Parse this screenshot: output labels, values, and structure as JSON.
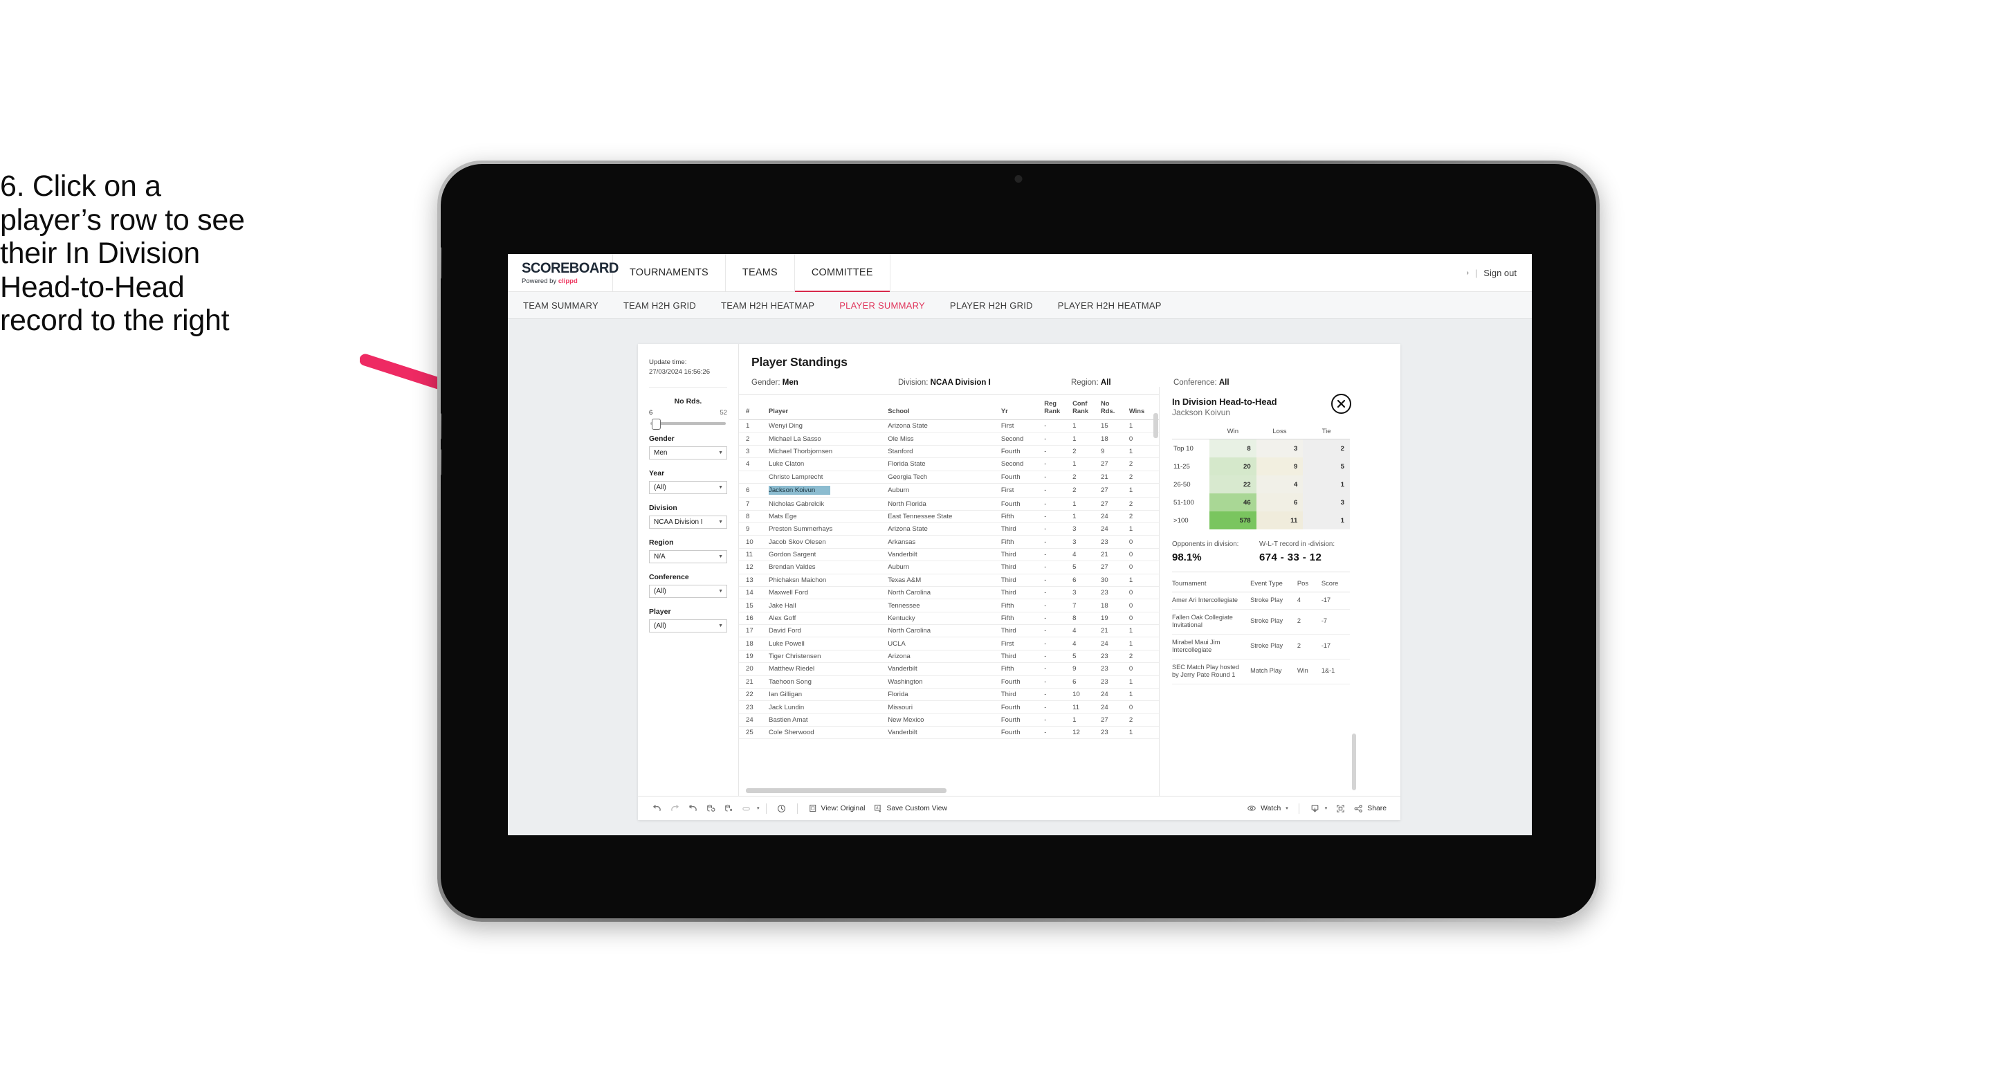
{
  "instruction": {
    "lines": [
      "6. Click on a",
      "player’s row to see",
      "their In Division",
      "Head-to-Head",
      "record to the right"
    ],
    "arrow_color": "#ee2a63"
  },
  "app": {
    "logo": {
      "word": "SCOREBOARD",
      "powered_prefix": "Powered by ",
      "brand": "clippd"
    },
    "topnav": [
      {
        "label": "TOURNAMENTS",
        "active": false
      },
      {
        "label": "TEAMS",
        "active": false
      },
      {
        "label": "COMMITTEE",
        "active": true
      }
    ],
    "topbar_right": {
      "chevron": "›",
      "separator": "|",
      "sign_out": "Sign out"
    },
    "subnav": [
      {
        "label": "TEAM SUMMARY",
        "active": false
      },
      {
        "label": "TEAM H2H GRID",
        "active": false
      },
      {
        "label": "TEAM H2H HEATMAP",
        "active": false
      },
      {
        "label": "PLAYER SUMMARY",
        "active": true
      },
      {
        "label": "PLAYER H2H GRID",
        "active": false
      },
      {
        "label": "PLAYER H2H HEATMAP",
        "active": false
      }
    ],
    "accent_color": "#e0365c"
  },
  "filters": {
    "update_time_label": "Update time:",
    "update_time_value": "27/03/2024 16:56:26",
    "slider": {
      "title": "No Rds.",
      "min": "6",
      "max": "52"
    },
    "groups": [
      {
        "label": "Gender",
        "value": "Men"
      },
      {
        "label": "Year",
        "value": "(All)"
      },
      {
        "label": "Division",
        "value": "NCAA Division I"
      },
      {
        "label": "Region",
        "value": "N/A"
      },
      {
        "label": "Conference",
        "value": "(All)"
      },
      {
        "label": "Player",
        "value": "(All)"
      }
    ]
  },
  "standings": {
    "title": "Player Standings",
    "meta": [
      {
        "label": "Gender: ",
        "value": "Men"
      },
      {
        "label": "Division: ",
        "value": "NCAA Division I"
      },
      {
        "label": "Region: ",
        "value": "All"
      },
      {
        "label": "Conference: ",
        "value": "All"
      }
    ],
    "columns": [
      "#",
      "Player",
      "School",
      "Yr",
      "Reg Rank",
      "Conf Rank",
      "No Rds.",
      "Wins"
    ],
    "columns_wrapped": [
      {
        "l1": "#",
        "l2": ""
      },
      {
        "l1": "Player",
        "l2": ""
      },
      {
        "l1": "School",
        "l2": ""
      },
      {
        "l1": "Yr",
        "l2": ""
      },
      {
        "l1": "Reg",
        "l2": "Rank"
      },
      {
        "l1": "Conf",
        "l2": "Rank"
      },
      {
        "l1": "No",
        "l2": "Rds."
      },
      {
        "l1": "Wins",
        "l2": ""
      }
    ],
    "rows": [
      {
        "rank": "1",
        "player": "Wenyi Ding",
        "school": "Arizona State",
        "yr": "First",
        "reg": "-",
        "conf": "1",
        "rds": "15",
        "wins": "1",
        "selected": false
      },
      {
        "rank": "2",
        "player": "Michael La Sasso",
        "school": "Ole Miss",
        "yr": "Second",
        "reg": "-",
        "conf": "1",
        "rds": "18",
        "wins": "0",
        "selected": false
      },
      {
        "rank": "3",
        "player": "Michael Thorbjornsen",
        "school": "Stanford",
        "yr": "Fourth",
        "reg": "-",
        "conf": "2",
        "rds": "9",
        "wins": "1",
        "selected": false
      },
      {
        "rank": "4",
        "player": "Luke Claton",
        "school": "Florida State",
        "yr": "Second",
        "reg": "-",
        "conf": "1",
        "rds": "27",
        "wins": "2",
        "selected": false
      },
      {
        "rank": "",
        "player": "Christo Lamprecht",
        "school": "Georgia Tech",
        "yr": "Fourth",
        "reg": "-",
        "conf": "2",
        "rds": "21",
        "wins": "2",
        "selected": false
      },
      {
        "rank": "6",
        "player": "Jackson Koivun",
        "school": "Auburn",
        "yr": "First",
        "reg": "-",
        "conf": "2",
        "rds": "27",
        "wins": "1",
        "selected": true
      },
      {
        "rank": "7",
        "player": "Nicholas Gabrelcik",
        "school": "North Florida",
        "yr": "Fourth",
        "reg": "-",
        "conf": "1",
        "rds": "27",
        "wins": "2",
        "selected": false
      },
      {
        "rank": "8",
        "player": "Mats Ege",
        "school": "East Tennessee State",
        "yr": "Fifth",
        "reg": "-",
        "conf": "1",
        "rds": "24",
        "wins": "2",
        "selected": false
      },
      {
        "rank": "9",
        "player": "Preston Summerhays",
        "school": "Arizona State",
        "yr": "Third",
        "reg": "-",
        "conf": "3",
        "rds": "24",
        "wins": "1",
        "selected": false
      },
      {
        "rank": "10",
        "player": "Jacob Skov Olesen",
        "school": "Arkansas",
        "yr": "Fifth",
        "reg": "-",
        "conf": "3",
        "rds": "23",
        "wins": "0",
        "selected": false
      },
      {
        "rank": "11",
        "player": "Gordon Sargent",
        "school": "Vanderbilt",
        "yr": "Third",
        "reg": "-",
        "conf": "4",
        "rds": "21",
        "wins": "0",
        "selected": false
      },
      {
        "rank": "12",
        "player": "Brendan Valdes",
        "school": "Auburn",
        "yr": "Third",
        "reg": "-",
        "conf": "5",
        "rds": "27",
        "wins": "0",
        "selected": false
      },
      {
        "rank": "13",
        "player": "Phichaksn Maichon",
        "school": "Texas A&M",
        "yr": "Third",
        "reg": "-",
        "conf": "6",
        "rds": "30",
        "wins": "1",
        "selected": false
      },
      {
        "rank": "14",
        "player": "Maxwell Ford",
        "school": "North Carolina",
        "yr": "Third",
        "reg": "-",
        "conf": "3",
        "rds": "23",
        "wins": "0",
        "selected": false
      },
      {
        "rank": "15",
        "player": "Jake Hall",
        "school": "Tennessee",
        "yr": "Fifth",
        "reg": "-",
        "conf": "7",
        "rds": "18",
        "wins": "0",
        "selected": false
      },
      {
        "rank": "16",
        "player": "Alex Goff",
        "school": "Kentucky",
        "yr": "Fifth",
        "reg": "-",
        "conf": "8",
        "rds": "19",
        "wins": "0",
        "selected": false
      },
      {
        "rank": "17",
        "player": "David Ford",
        "school": "North Carolina",
        "yr": "Third",
        "reg": "-",
        "conf": "4",
        "rds": "21",
        "wins": "1",
        "selected": false
      },
      {
        "rank": "18",
        "player": "Luke Powell",
        "school": "UCLA",
        "yr": "First",
        "reg": "-",
        "conf": "4",
        "rds": "24",
        "wins": "1",
        "selected": false
      },
      {
        "rank": "19",
        "player": "Tiger Christensen",
        "school": "Arizona",
        "yr": "Third",
        "reg": "-",
        "conf": "5",
        "rds": "23",
        "wins": "2",
        "selected": false
      },
      {
        "rank": "20",
        "player": "Matthew Riedel",
        "school": "Vanderbilt",
        "yr": "Fifth",
        "reg": "-",
        "conf": "9",
        "rds": "23",
        "wins": "0",
        "selected": false
      },
      {
        "rank": "21",
        "player": "Taehoon Song",
        "school": "Washington",
        "yr": "Fourth",
        "reg": "-",
        "conf": "6",
        "rds": "23",
        "wins": "1",
        "selected": false
      },
      {
        "rank": "22",
        "player": "Ian Gilligan",
        "school": "Florida",
        "yr": "Third",
        "reg": "-",
        "conf": "10",
        "rds": "24",
        "wins": "1",
        "selected": false
      },
      {
        "rank": "23",
        "player": "Jack Lundin",
        "school": "Missouri",
        "yr": "Fourth",
        "reg": "-",
        "conf": "11",
        "rds": "24",
        "wins": "0",
        "selected": false
      },
      {
        "rank": "24",
        "player": "Bastien Amat",
        "school": "New Mexico",
        "yr": "Fourth",
        "reg": "-",
        "conf": "1",
        "rds": "27",
        "wins": "2",
        "selected": false
      },
      {
        "rank": "25",
        "player": "Cole Sherwood",
        "school": "Vanderbilt",
        "yr": "Fourth",
        "reg": "-",
        "conf": "12",
        "rds": "23",
        "wins": "1",
        "selected": false
      }
    ],
    "selection_color": "#8cbcd0"
  },
  "detail": {
    "title": "In Division Head-to-Head",
    "player": "Jackson Koivun",
    "close_icon": "close-circle-icon",
    "h2h": {
      "columns": [
        "",
        "Win",
        "Loss",
        "Tie"
      ],
      "rows": [
        {
          "label": "Top 10",
          "win": "8",
          "loss": "3",
          "tie": "2",
          "win_bg": "#e8f1e4",
          "loss_bg": "#f2f1ec",
          "tie_bg": "#eeeeee"
        },
        {
          "label": "11-25",
          "win": "20",
          "loss": "9",
          "tie": "5",
          "win_bg": "#d5e8cb",
          "loss_bg": "#f2efe0",
          "tie_bg": "#eeeeee"
        },
        {
          "label": "26-50",
          "win": "22",
          "loss": "4",
          "tie": "1",
          "win_bg": "#d8e9cf",
          "loss_bg": "#f1f0e8",
          "tie_bg": "#eeeeee"
        },
        {
          "label": "51-100",
          "win": "46",
          "loss": "6",
          "tie": "3",
          "win_bg": "#a9d795",
          "loss_bg": "#f1efe4",
          "tie_bg": "#eeeeee"
        },
        {
          "label": ">100",
          "win": "578",
          "loss": "11",
          "tie": "1",
          "win_bg": "#7ac55f",
          "loss_bg": "#f0ecdc",
          "tie_bg": "#eeeeee"
        }
      ]
    },
    "stats": [
      {
        "label": "Opponents in division:",
        "value": "98.1%"
      },
      {
        "label": "W-L-T record in -division:",
        "value": "674 - 33 - 12"
      }
    ],
    "tournament_columns": [
      "Tournament",
      "Event Type",
      "Pos",
      "Score"
    ],
    "tournaments": [
      {
        "name": "Amer Ari Intercollegiate",
        "type": "Stroke Play",
        "pos": "4",
        "score": "-17"
      },
      {
        "name": "Fallen Oak Collegiate Invitational",
        "type": "Stroke Play",
        "pos": "2",
        "score": "-7"
      },
      {
        "name": "Mirabel Maui Jim Intercollegiate",
        "type": "Stroke Play",
        "pos": "2",
        "score": "-17"
      },
      {
        "name": "SEC Match Play hosted by Jerry Pate Round 1",
        "type": "Match Play",
        "pos": "Win",
        "score": "1&-1"
      }
    ]
  },
  "toolbar": {
    "icons": [
      "undo-icon",
      "redo-icon",
      "revert-icon",
      "refresh-data-icon",
      "pause-data-icon",
      "highlight-icon"
    ],
    "highlight_caret": "▾",
    "clock_icon": "clock-icon",
    "view_label": "View: Original",
    "save_label": "Save Custom View",
    "watch_label": "Watch",
    "watch_caret": "▾",
    "download_caret": "▾",
    "share_label": "Share"
  }
}
